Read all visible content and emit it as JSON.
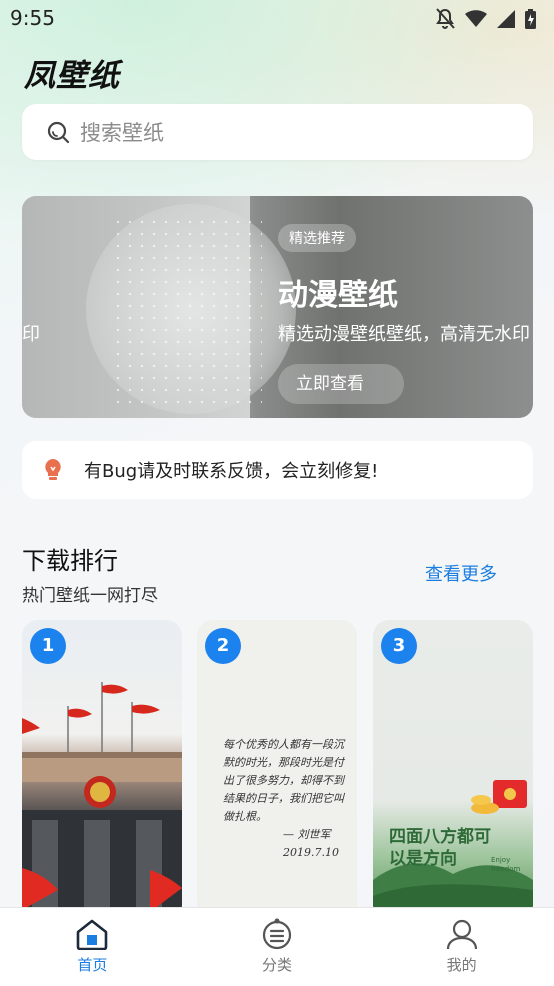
{
  "status": {
    "time": "9:55"
  },
  "app": {
    "title": "凤壁纸"
  },
  "search": {
    "placeholder": "搜索壁纸"
  },
  "banner": {
    "cut_text": "印",
    "tag": "精选推荐",
    "title": "动漫壁纸",
    "desc": "精选动漫壁纸壁纸，高清无水印",
    "button": "立即查看"
  },
  "notice": {
    "text": "有Bug请及时联系反馈，会立刻修复!"
  },
  "ranking": {
    "title": "下载排行",
    "subtitle": "热门壁纸一网打尽",
    "more": "查看更多",
    "cards": [
      {
        "rank": "1"
      },
      {
        "rank": "2",
        "note": "每个优秀的人都有一段沉默的时光，那段时光是付出了很多努力，却得不到结果的日子，我们把它叫做扎根。",
        "signature": "— 刘世军",
        "date": "2019.7.10"
      },
      {
        "rank": "3",
        "text": "四面八方都可以是方向",
        "small": "Enjoy freedom"
      }
    ]
  },
  "tabs": [
    {
      "label": "首页",
      "icon": "home-icon",
      "active": true
    },
    {
      "label": "分类",
      "icon": "category-icon",
      "active": false
    },
    {
      "label": "我的",
      "icon": "user-icon",
      "active": false
    }
  ],
  "colors": {
    "accent": "#1a7de1",
    "rank_badge": "#1b82ee",
    "notice_icon": "#e8704e"
  }
}
